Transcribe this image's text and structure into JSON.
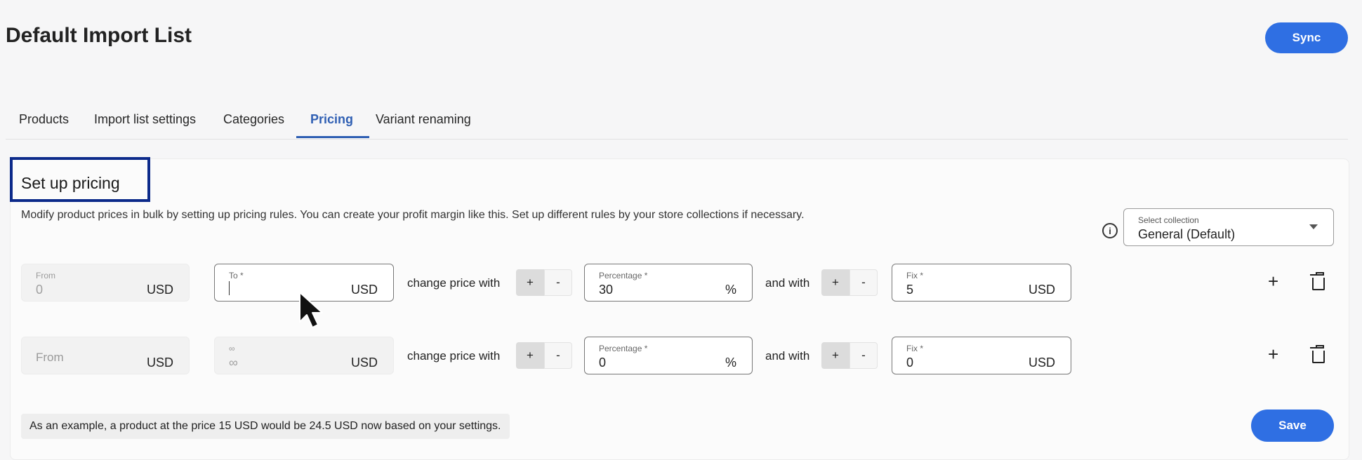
{
  "header": {
    "title": "Default Import List",
    "sync_label": "Sync"
  },
  "tabs": [
    {
      "label": "Products",
      "active": false
    },
    {
      "label": "Import list settings",
      "active": false
    },
    {
      "label": "Categories",
      "active": false
    },
    {
      "label": "Pricing",
      "active": true
    },
    {
      "label": "Variant renaming",
      "active": false
    }
  ],
  "pricing": {
    "section_title": "Set up pricing",
    "description": "Modify product prices in bulk by setting up pricing rules. You can create your profit margin like this. Set up different rules by your store collections if necessary.",
    "collection_select": {
      "label": "Select collection",
      "value": "General (Default)"
    },
    "change_price_with_label": "change price with",
    "and_with_label": "and with",
    "plus_label": "+",
    "minus_label": "-",
    "percent_symbol": "%",
    "rules": [
      {
        "from_label": "From",
        "from_value": "0",
        "from_unit": "USD",
        "to_label": "To *",
        "to_value": "",
        "to_unit": "USD",
        "percentage_label": "Percentage *",
        "percentage_value": "30",
        "fix_label": "Fix *",
        "fix_value": "5",
        "fix_unit": "USD"
      },
      {
        "from_placeholder": "From",
        "from_unit": "USD",
        "to_label": "∞",
        "to_value": "∞",
        "to_unit": "USD",
        "percentage_label": "Percentage *",
        "percentage_value": "0",
        "fix_label": "Fix *",
        "fix_value": "0",
        "fix_unit": "USD"
      }
    ],
    "add_icon": "+",
    "example_text": "As an example, a product at the price 15 USD would be 24.5 USD now based on your settings.",
    "save_label": "Save"
  },
  "colors": {
    "primary": "#2f6fe3",
    "active_tab": "#2f5fb3",
    "highlight_box": "#0c2a8a"
  }
}
